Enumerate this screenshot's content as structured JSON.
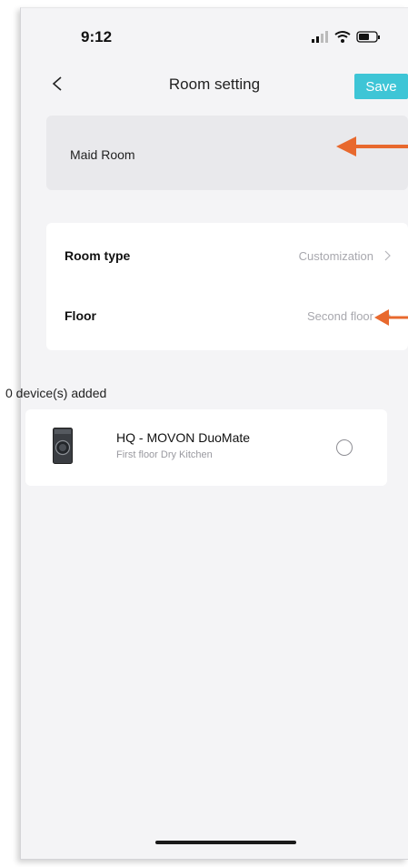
{
  "status_bar": {
    "time": "9:12",
    "icons": [
      "signal-bars-icon",
      "wifi-icon",
      "battery-icon"
    ]
  },
  "nav": {
    "back_icon": "chevron-left-icon",
    "title": "Room setting",
    "save_label": "Save"
  },
  "room_name": {
    "value": "Maid Room"
  },
  "settings": [
    {
      "label": "Room type",
      "value": "Customization",
      "icon": "chevron-right-icon"
    },
    {
      "label": "Floor",
      "value": "Second floor",
      "icon": "chevron-right-icon"
    }
  ],
  "devices": {
    "header": "0 device(s) added",
    "items": [
      {
        "name": "HQ - MOVON DuoMate",
        "location": "First floor Dry Kitchen",
        "selected": false
      }
    ]
  },
  "colors": {
    "accent": "#3ec5d6",
    "annotation_arrow": "#e8692e",
    "background": "#f4f4f6",
    "name_field_bg": "#e9e9ec"
  }
}
